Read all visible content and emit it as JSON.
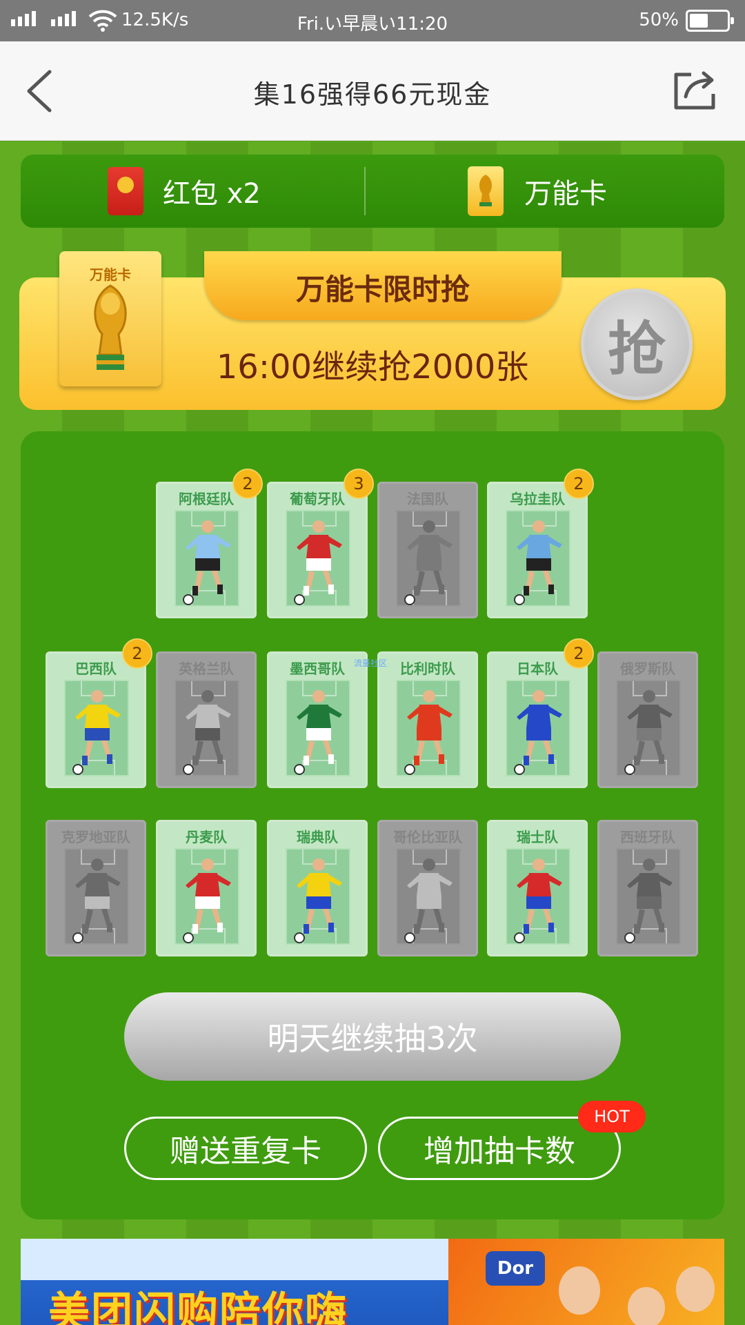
{
  "status_bar": {
    "speed": "12.5K/s",
    "time": "Fri.い早晨い11:20",
    "battery": "50%"
  },
  "navbar": {
    "title": "集16强得66元现金"
  },
  "topbar": {
    "red_packet_label": "红包  x2",
    "wild_card_label": "万能卡"
  },
  "promo": {
    "card_label": "万能卡",
    "ribbon_title": "万能卡限时抢",
    "subtitle": "16:00继续抢2000张",
    "grab_label": "抢"
  },
  "cards": [
    {
      "name": "阿根廷队",
      "count": "2",
      "collected": true,
      "jersey": "#8ec2ef",
      "shorts": "#222222"
    },
    {
      "name": "葡萄牙队",
      "count": "3",
      "collected": true,
      "jersey": "#d32a2a",
      "shorts": "#ffffff"
    },
    {
      "name": "法国队",
      "count": "",
      "collected": false,
      "jersey": "#7a7a7a",
      "shorts": "#7a7a7a"
    },
    {
      "name": "乌拉圭队",
      "count": "2",
      "collected": true,
      "jersey": "#68a7df",
      "shorts": "#222222"
    },
    {
      "name": "巴西队",
      "count": "2",
      "collected": true,
      "jersey": "#f2d40f",
      "shorts": "#2a4fb8"
    },
    {
      "name": "英格兰队",
      "count": "",
      "collected": false,
      "jersey": "#bdbdbd",
      "shorts": "#5a5a5a"
    },
    {
      "name": "墨西哥队",
      "count": "",
      "collected": true,
      "jersey": "#1f7a3a",
      "shorts": "#ffffff"
    },
    {
      "name": "比利时队",
      "count": "",
      "collected": true,
      "jersey": "#e03a1e",
      "shorts": "#e03a1e"
    },
    {
      "name": "日本队",
      "count": "2",
      "collected": true,
      "jersey": "#2548c8",
      "shorts": "#2548c8"
    },
    {
      "name": "俄罗斯队",
      "count": "",
      "collected": false,
      "jersey": "#5f5f5f",
      "shorts": "#7a7a7a"
    },
    {
      "name": "克罗地亚队",
      "count": "",
      "collected": false,
      "jersey": "#6a6a6a",
      "shorts": "#bdbdbd"
    },
    {
      "name": "丹麦队",
      "count": "",
      "collected": true,
      "jersey": "#d62a2a",
      "shorts": "#ffffff"
    },
    {
      "name": "瑞典队",
      "count": "",
      "collected": true,
      "jersey": "#f4d20f",
      "shorts": "#2548c8"
    },
    {
      "name": "哥伦比亚队",
      "count": "",
      "collected": false,
      "jersey": "#bdbdbd",
      "shorts": "#bdbdbd"
    },
    {
      "name": "瑞士队",
      "count": "",
      "collected": true,
      "jersey": "#d62a2a",
      "shorts": "#2548c8"
    },
    {
      "name": "西班牙队",
      "count": "",
      "collected": false,
      "jersey": "#5f5f5f",
      "shorts": "#6a6a6a"
    }
  ],
  "watermark": "流量社区",
  "buttons": {
    "draw": "明天继续抽3次",
    "gift": "赠送重复卡",
    "add": "增加抽卡数",
    "hot": "HOT"
  },
  "ad": {
    "text": "美团闪购陪你嗨",
    "logo": "Dor"
  },
  "colors": {
    "accent": "#3f9c0f",
    "gold": "#fbc02d",
    "badge": "#f7b619",
    "hot": "#ff2a17"
  }
}
